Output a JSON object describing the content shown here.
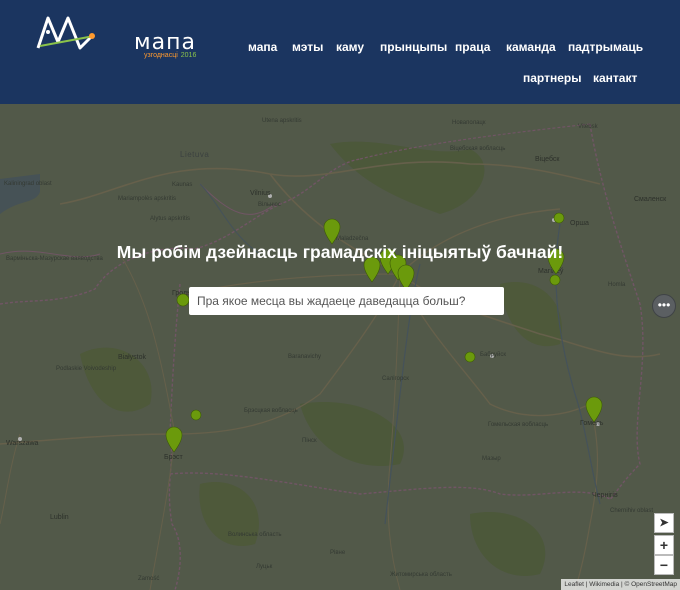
{
  "brand": {
    "name": "мапа",
    "subtitle": "узгоднасці",
    "year": "2016"
  },
  "nav": [
    {
      "label": "мапа"
    },
    {
      "label": "мэты"
    },
    {
      "label": "каму"
    },
    {
      "label": "прынцыпы"
    },
    {
      "label": "праца"
    },
    {
      "label": "каманда"
    },
    {
      "label": "падтрымаць"
    },
    {
      "label": "партнеры"
    },
    {
      "label": "кантакт"
    }
  ],
  "hero": {
    "title": "Мы робім дзейнасць грамадскіх ініцыятыў бачнай!",
    "search_placeholder": "Пра якое месца вы жадаеце даведацца больш?"
  },
  "map": {
    "controls": {
      "more": "•••",
      "locate": "➤",
      "zoom_in": "+",
      "zoom_out": "−"
    },
    "attribution": "Leaflet | Wikimedia | © OpenStreetMap",
    "labels": [
      "Utena apskritis",
      "Новаполацк",
      "Віцебск",
      "Lietuva",
      "Vitebsk",
      "Kaunas",
      "Віцебская вобласць",
      "Смаленск",
      "Kaliningrad oblast",
      "Vilnius",
      "Mariampolės apskritis",
      "Вільнюс",
      "Alytus apskritis",
      "Орша",
      "Maladzečna",
      "Магілёў",
      "Варміньска-Мазурскае ваяводства",
      "Гродна",
      "Homla",
      "Białystok",
      "Baranavichy",
      "Бабруйск",
      "Podlaskie Voivodeship",
      "Салігорск",
      "Брэсцкая вобласць",
      "Гомельская вобласць",
      "Warszawa",
      "Брэст",
      "Пінск",
      "Мазыр",
      "Гомель",
      "Lublin",
      "Волинська область",
      "Рівне",
      "Zamość",
      "Луцьк",
      "Чернігів",
      "Житомирська область",
      "Chernihiv oblast"
    ]
  },
  "colors": {
    "header": "#1b3560",
    "marker": "#6b9a0c",
    "accent_orange": "#ff9a2e",
    "accent_green": "#8bc34a"
  }
}
